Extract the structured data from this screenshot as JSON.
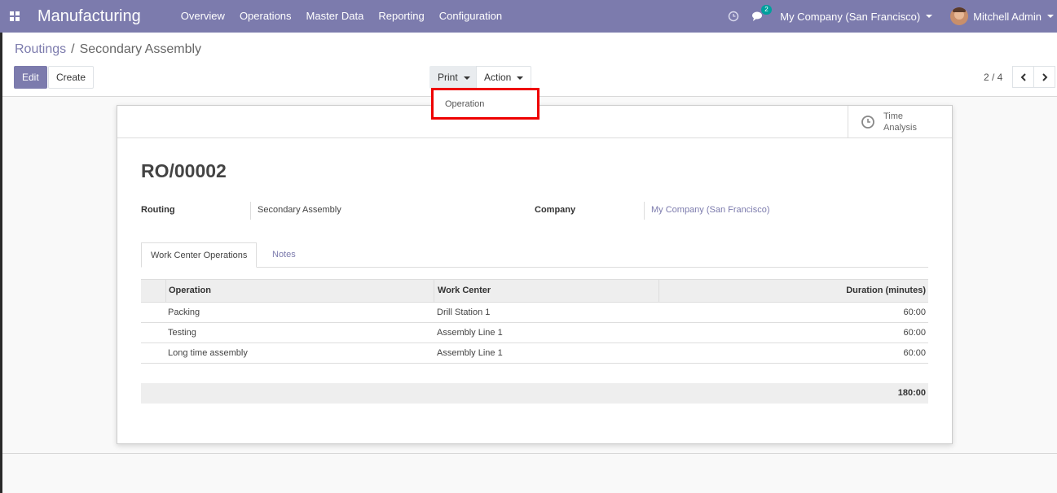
{
  "navbar": {
    "brand": "Manufacturing",
    "menu": [
      "Overview",
      "Operations",
      "Master Data",
      "Reporting",
      "Configuration"
    ],
    "chat_count": "2",
    "company": "My Company (San Francisco)",
    "user": "Mitchell Admin",
    "color": "#7c7bad"
  },
  "breadcrumb": {
    "parent": "Routings",
    "separator": "/",
    "current": "Secondary Assembly"
  },
  "buttons": {
    "edit": "Edit",
    "create": "Create",
    "print": "Print",
    "action": "Action"
  },
  "pager": {
    "value": "2 / 4"
  },
  "print_menu": {
    "items": [
      "Operation"
    ]
  },
  "stat_button": {
    "label": "Time Analysis"
  },
  "record": {
    "name": "RO/00002",
    "routing_label": "Routing",
    "routing_value": "Secondary Assembly",
    "company_label": "Company",
    "company_value": "My Company (San Francisco)"
  },
  "tabs": [
    "Work Center Operations",
    "Notes"
  ],
  "table": {
    "headers": [
      "Operation",
      "Work Center",
      "Duration (minutes)"
    ],
    "rows": [
      {
        "operation": "Packing",
        "work_center": "Drill Station 1",
        "duration": "60:00"
      },
      {
        "operation": "Testing",
        "work_center": "Assembly Line 1",
        "duration": "60:00"
      },
      {
        "operation": "Long time assembly",
        "work_center": "Assembly Line 1",
        "duration": "60:00"
      }
    ],
    "total": "180:00"
  }
}
